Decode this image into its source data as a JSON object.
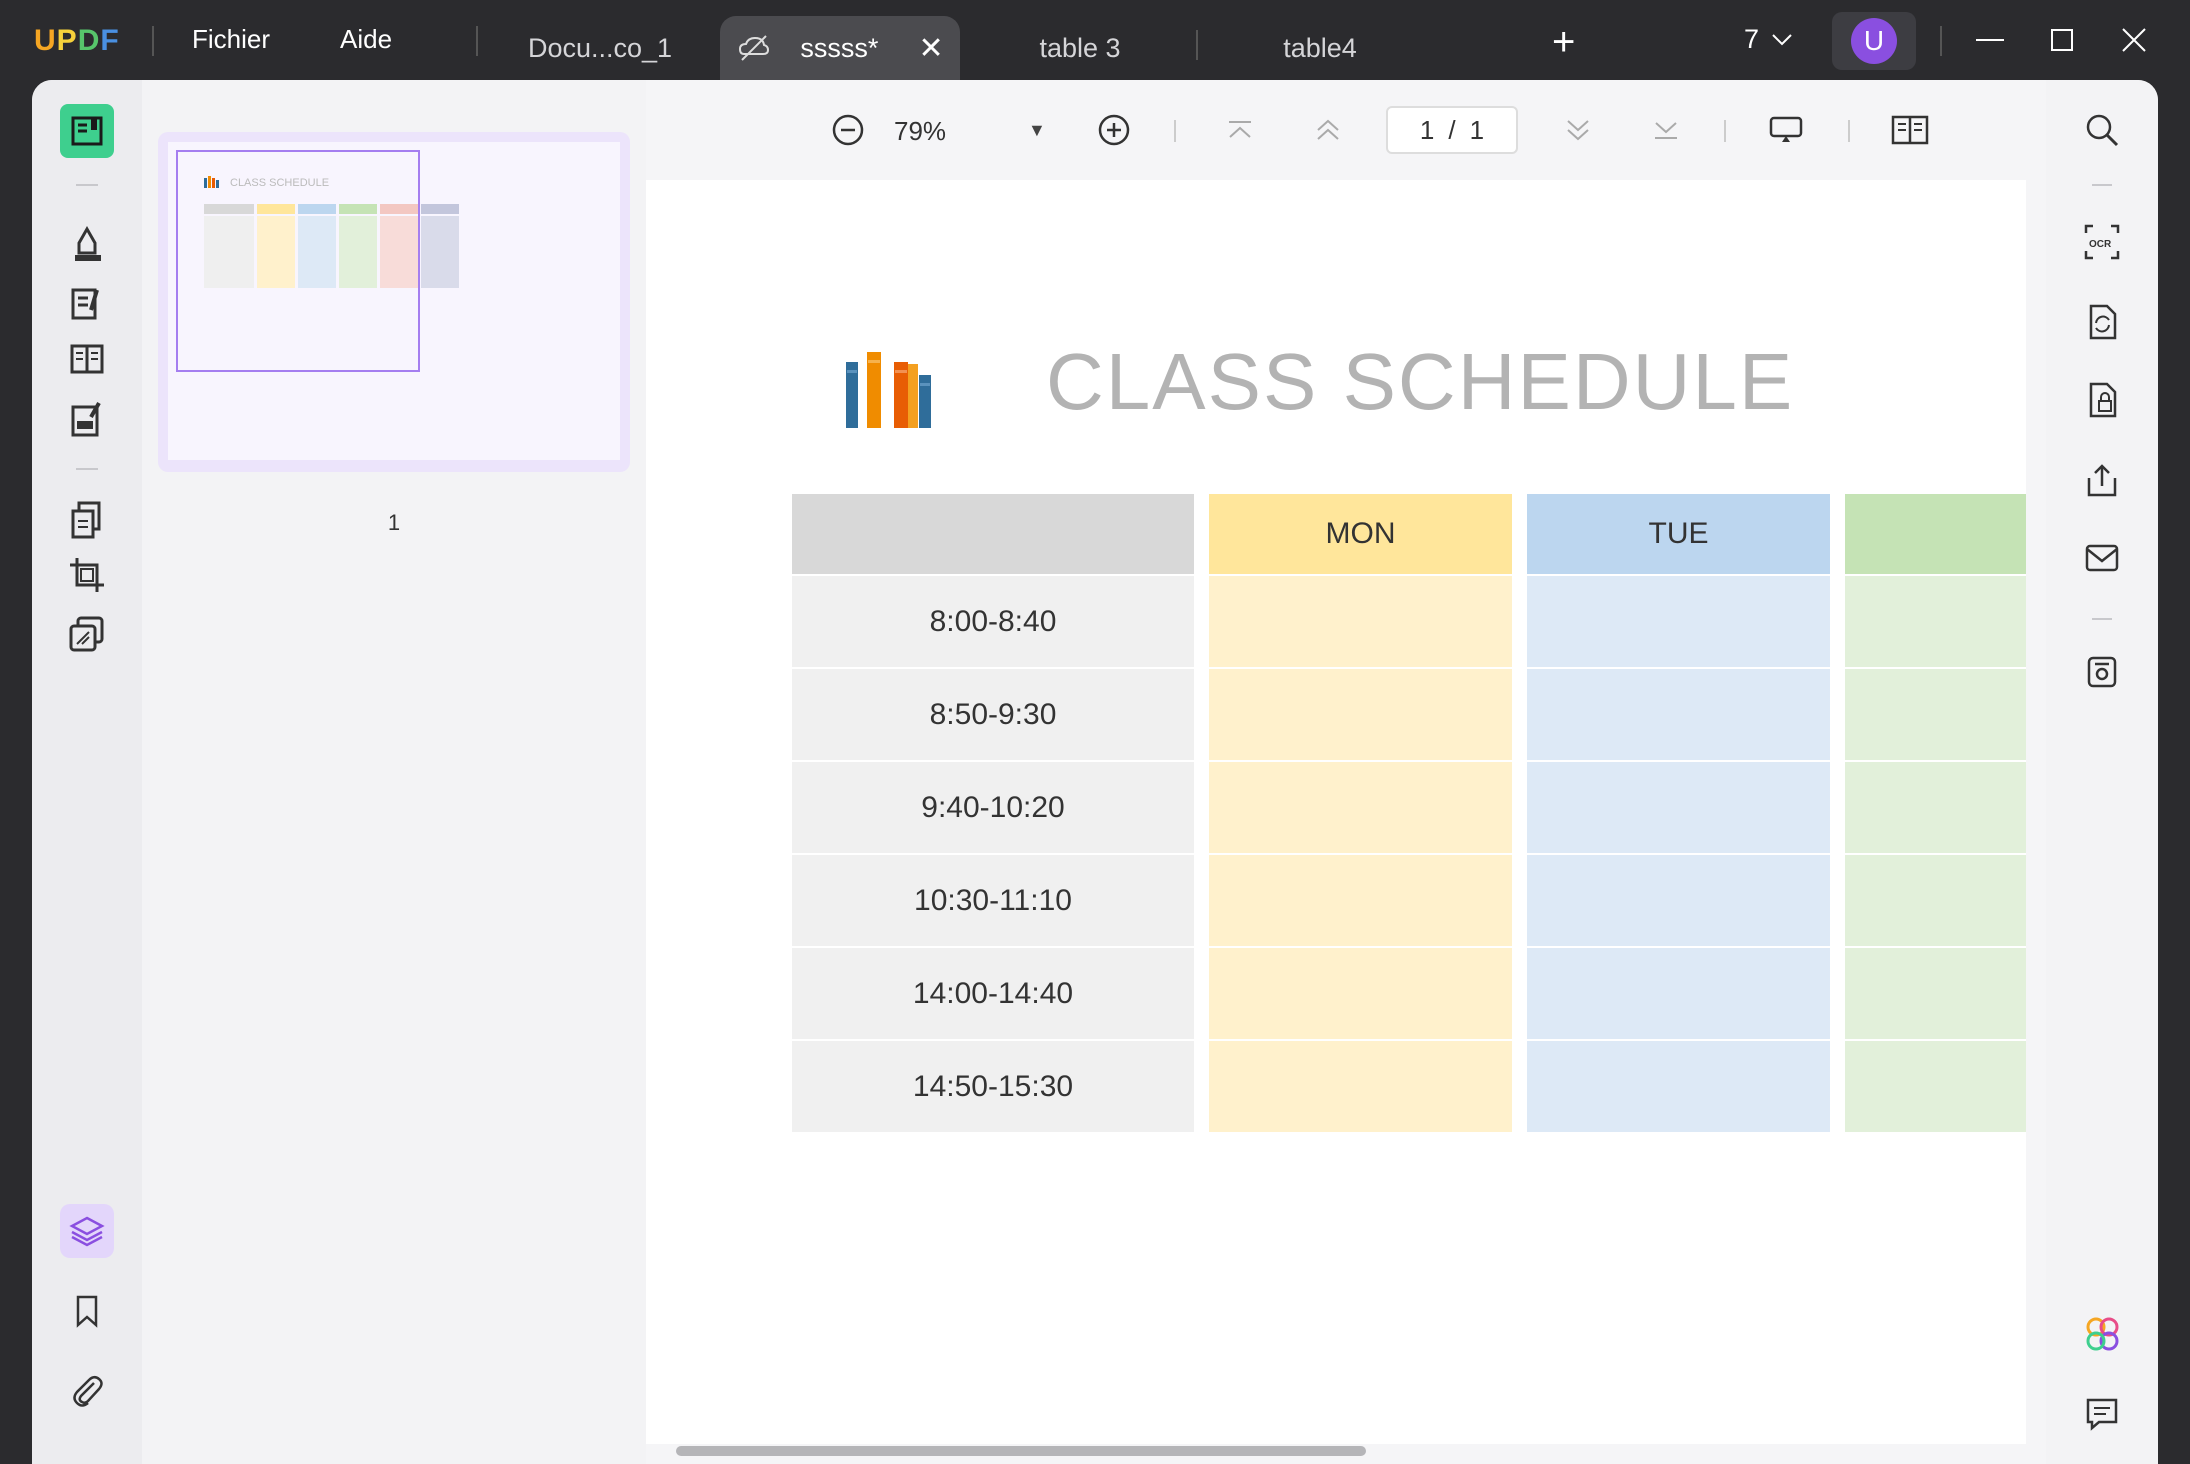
{
  "app": {
    "logo": {
      "u": "U",
      "p": "P",
      "d": "D",
      "f": "F"
    },
    "menu": {
      "file": "Fichier",
      "help": "Aide"
    },
    "tabs": [
      {
        "label": "Docu...co_1"
      },
      {
        "label": "sssss*"
      },
      {
        "label": "table 3"
      },
      {
        "label": "table4"
      }
    ],
    "new_tab": "+",
    "tab_count": "7",
    "user_initial": "U"
  },
  "toolbar": {
    "zoom": "79%",
    "zoom_caret": "▼",
    "page_current": "1",
    "page_sep": "/",
    "page_total": "1"
  },
  "thumbnails": {
    "page_number": "1",
    "mini_title": "CLASS SCHEDULE"
  },
  "document": {
    "title": "CLASS SCHEDULE",
    "headers": [
      "",
      "MON",
      "TUE",
      ""
    ],
    "times": [
      "8:00-8:40",
      "8:50-9:30",
      "9:40-10:20",
      "10:30-11:10",
      "14:00-14:40",
      "14:50-15:30"
    ]
  },
  "colors": {
    "accent_green": "#3ecf8e",
    "accent_purple": "#8a4fe0",
    "mon": "#ffe69b",
    "tue": "#bcd6ef",
    "wed": "#c5e3b5"
  }
}
